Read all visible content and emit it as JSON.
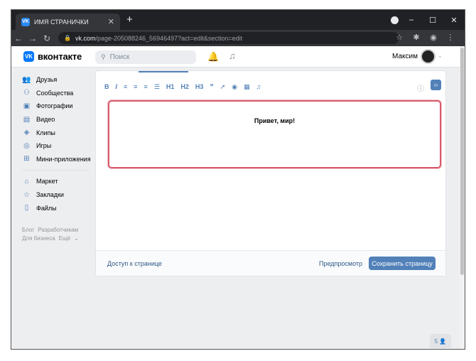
{
  "browser": {
    "tab_title": "ИМЯ СТРАНИЧКИ",
    "tab_favicon": "VK",
    "url_host": "vk.com",
    "url_path": "/page-205088246_56946497?act=edit&section=edit"
  },
  "header": {
    "logo_mark": "VK",
    "logo_text": "вконтакте",
    "search_placeholder": "Поиск",
    "user_name": "Максим"
  },
  "sidebar": {
    "items": [
      {
        "label": "Друзья",
        "icon": "friends-icon"
      },
      {
        "label": "Сообщества",
        "icon": "communities-icon"
      },
      {
        "label": "Фотографии",
        "icon": "photos-icon"
      },
      {
        "label": "Видео",
        "icon": "video-icon"
      },
      {
        "label": "Клипы",
        "icon": "clips-icon"
      },
      {
        "label": "Игры",
        "icon": "games-icon"
      },
      {
        "label": "Мини-приложения",
        "icon": "mini-apps-icon"
      }
    ],
    "items2": [
      {
        "label": "Маркет",
        "icon": "market-icon"
      },
      {
        "label": "Закладки",
        "icon": "bookmarks-icon"
      },
      {
        "label": "Файлы",
        "icon": "files-icon"
      }
    ],
    "links": {
      "blog": "Блог",
      "developers": "Разработчикам",
      "business": "Для бизнеса",
      "more": "Ещё"
    }
  },
  "editor": {
    "toolbar": [
      "B",
      "I",
      "≡",
      "≡",
      "≡",
      "☰",
      "H1",
      "H2",
      "H3",
      "❞",
      "➚",
      "◉",
      "▦",
      "♫"
    ],
    "content": "Привет, мир!"
  },
  "footer": {
    "access": "Доступ к странице",
    "preview": "Предпросмотр",
    "save": "Сохранить страницу"
  },
  "chat_widget": "5"
}
